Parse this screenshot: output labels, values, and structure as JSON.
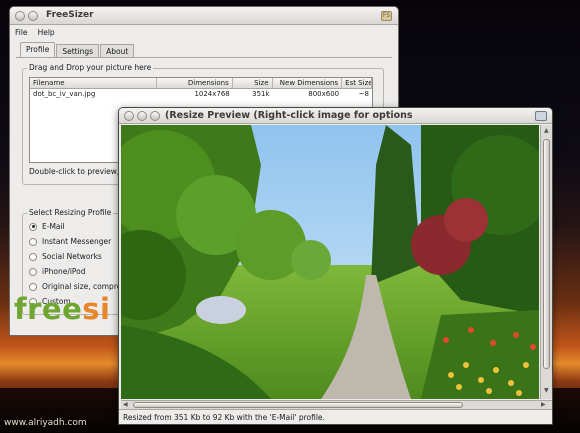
{
  "desktop": {
    "watermark": "www.alriyadh.com"
  },
  "main_window": {
    "title": "FreeSizer",
    "title_icon_text": "FS",
    "menu": [
      "File",
      "Help"
    ],
    "tabs": [
      {
        "label": "Profile",
        "active": true
      },
      {
        "label": "Settings",
        "active": false
      },
      {
        "label": "About",
        "active": false
      }
    ],
    "drag_group_label": "Drag and Drop your picture here",
    "file_list": {
      "columns": [
        "Filename",
        "Dimensions",
        "Size",
        "New Dimensions",
        "Est Size"
      ],
      "rows": [
        {
          "filename": "dot_bc_iv_van.jpg",
          "dimensions": "1024x768",
          "size": "351k",
          "new_dimensions": "800x600",
          "est_size": "~8"
        }
      ]
    },
    "hint": "Double-click to preview, ri",
    "profile_group_label": "Select Resizing Profile",
    "profiles": [
      {
        "label": "E-Mail",
        "selected": true
      },
      {
        "label": "Instant Messenger",
        "selected": false
      },
      {
        "label": "Social Networks",
        "selected": false
      },
      {
        "label": "iPhone/iPod",
        "selected": false
      },
      {
        "label": "Original size, compres",
        "selected": false
      },
      {
        "label": "Custom",
        "selected": false
      }
    ],
    "logo": {
      "green": "free",
      "orange": "si",
      "colors": {
        "green": "#6fa630",
        "orange": "#e8862a"
      }
    }
  },
  "preview_window": {
    "title": "(Resize Preview (Right-click image for options",
    "status": "Resized from 351 Kb to 92 Kb with the 'E-Mail' profile."
  }
}
